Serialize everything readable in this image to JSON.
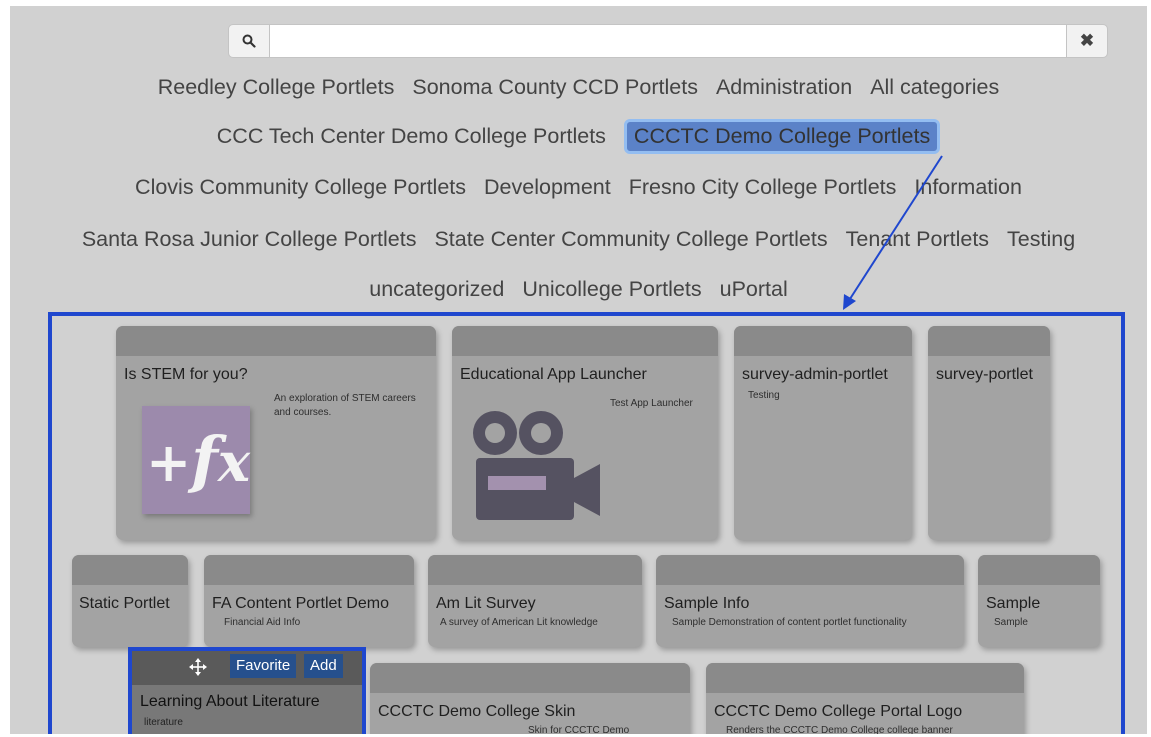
{
  "search": {
    "value": "",
    "placeholder": "",
    "clear_label": "✖"
  },
  "categories": {
    "row1": [
      "Reedley College Portlets",
      "Sonoma County CCD Portlets",
      "Administration",
      "All categories"
    ],
    "row2": [
      "CCC Tech Center Demo College Portlets",
      "CCCTC Demo College Portlets"
    ],
    "row3": [
      "Clovis Community College Portlets",
      "Development",
      "Fresno City College Portlets",
      "Information"
    ],
    "row4": [
      "Santa Rosa Junior College Portlets",
      "State Center Community College Portlets",
      "Tenant Portlets",
      "Testing"
    ],
    "row5": [
      "uncategorized",
      "Unicollege Portlets",
      "uPortal"
    ],
    "selected": "CCCTC Demo College Portlets"
  },
  "annotation_color": "#1f47ce",
  "selected_color": "#5b82c8",
  "portlets": {
    "stem": {
      "title": "Is STEM for you?",
      "desc": "An exploration of STEM careers and courses.",
      "icon": "function-fx-icon"
    },
    "launcher": {
      "title": "Educational App Launcher",
      "desc": "Test App Launcher",
      "icon": "video-camera-icon"
    },
    "survey_admin": {
      "title": "survey-admin-portlet",
      "desc": "Testing"
    },
    "survey": {
      "title": "survey-portlet"
    },
    "static": {
      "title": "Static Portlet"
    },
    "fa_content": {
      "title": "FA Content Portlet Demo",
      "desc": "Financial Aid Info"
    },
    "am_lit": {
      "title": "Am Lit Survey",
      "desc": "A survey of American Lit knowledge"
    },
    "sample_info": {
      "title": "Sample Info",
      "desc": "Sample Demonstration of content portlet functionality"
    },
    "sample": {
      "title": "Sample",
      "desc": "Sample"
    },
    "literature": {
      "title": "Learning About Literature",
      "desc": "literature",
      "favorite_label": "Favorite",
      "add_label": "Add"
    },
    "skin": {
      "title": "CCCTC Demo College Skin",
      "desc": "Skin for CCCTC Demo"
    },
    "logo": {
      "title": "CCCTC Demo College Portal Logo",
      "desc": "Renders the CCCTC Demo College college banner"
    }
  }
}
